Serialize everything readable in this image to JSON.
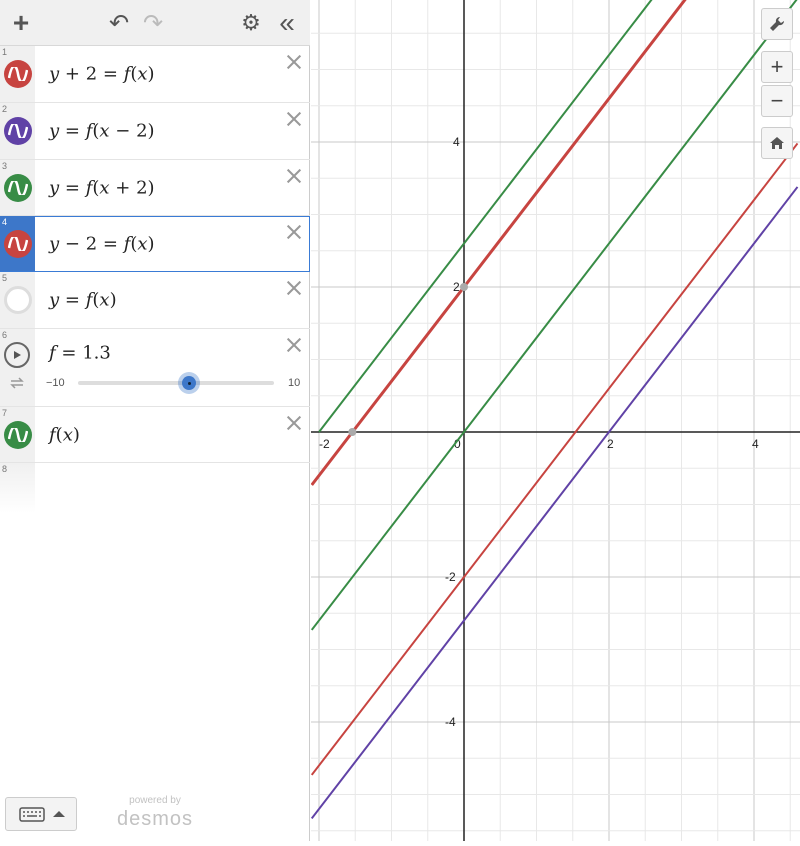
{
  "toolbar": {
    "add": "+",
    "undo": "↶",
    "redo": "↷",
    "collapse": "«",
    "settings": "⚙"
  },
  "expressions": [
    {
      "num": "1",
      "color": "#c74440",
      "parts": [
        "y",
        " + 2 = ",
        "f",
        "(",
        "x",
        ")"
      ]
    },
    {
      "num": "2",
      "color": "#6042a6",
      "parts": [
        "y",
        " = ",
        "f",
        "(",
        "x",
        " − 2)"
      ]
    },
    {
      "num": "3",
      "color": "#388c46",
      "parts": [
        "y",
        " = ",
        "f",
        "(",
        "x",
        " + 2)"
      ]
    },
    {
      "num": "4",
      "color": "#c74440",
      "parts": [
        "y",
        " − 2 = ",
        "f",
        "(",
        "x",
        ")"
      ]
    },
    {
      "num": "5",
      "color": "none",
      "parts": [
        "y",
        " = ",
        "f",
        "(",
        "x",
        ")"
      ]
    },
    {
      "num": "6",
      "slider": {
        "variable": "f",
        "value": "1.3",
        "min": "−10",
        "max": "10",
        "fraction": 0.565
      }
    },
    {
      "num": "7",
      "color": "#388c46",
      "parts": [
        "f",
        "(",
        "x",
        ")"
      ]
    },
    {
      "num": "8"
    }
  ],
  "footer": {
    "powered_by": "powered by",
    "brand": "desmos"
  },
  "graph_controls": {
    "wrench": "wrench-icon",
    "zoom_in": "+",
    "zoom_out": "−",
    "home": "home-icon"
  },
  "chart_data": {
    "type": "line",
    "xlim": [
      -2.1,
      4.6
    ],
    "ylim": [
      -5.8,
      5.9
    ],
    "grid": true,
    "x_ticks": [
      "-2",
      "0",
      "2",
      "4"
    ],
    "y_ticks": [
      "4",
      "2",
      "-2",
      "-4"
    ],
    "series": [
      {
        "color": "#388c46",
        "width": 2,
        "points": [
          [
            -2,
            0
          ],
          [
            4.6,
            8.58
          ]
        ]
      },
      {
        "color": "#c74440",
        "width": 3,
        "points": [
          [
            -2.1,
            -0.73
          ],
          [
            4.6,
            7.98
          ]
        ]
      },
      {
        "color": "#388c46",
        "width": 2,
        "points": [
          [
            -2.1,
            -2.73
          ],
          [
            4.6,
            5.98
          ]
        ]
      },
      {
        "color": "#c74440",
        "width": 2,
        "points": [
          [
            -2.1,
            -4.73
          ],
          [
            4.6,
            3.98
          ]
        ]
      },
      {
        "color": "#6042a6",
        "width": 2,
        "points": [
          [
            -2.1,
            -5.33
          ],
          [
            4.6,
            3.38
          ]
        ]
      }
    ],
    "points": [
      [
        0,
        2
      ],
      [
        -1.54,
        0
      ]
    ]
  }
}
